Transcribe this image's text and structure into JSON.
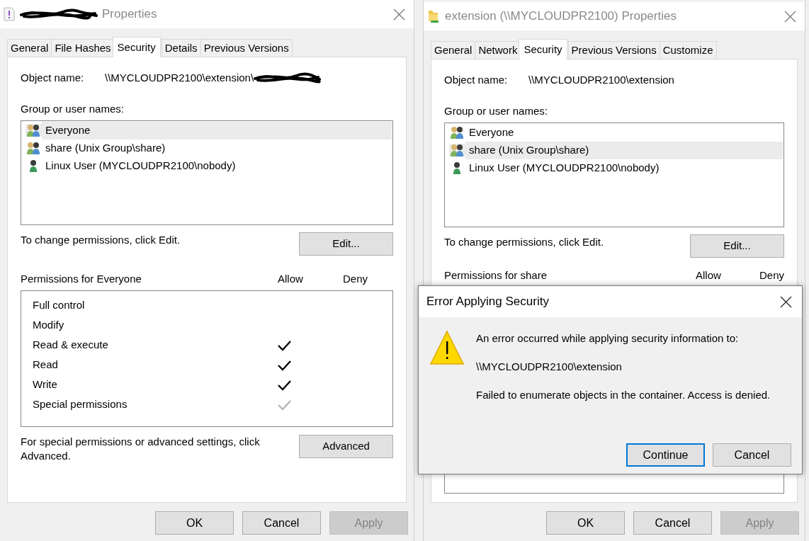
{
  "windows": [
    {
      "title": "Properties",
      "title_redacted": true,
      "tabs": [
        {
          "label": "General",
          "selected": false
        },
        {
          "label": "File Hashes",
          "selected": false
        },
        {
          "label": "Security",
          "selected": true
        },
        {
          "label": "Details",
          "selected": false
        },
        {
          "label": "Previous Versions",
          "selected": false
        }
      ],
      "object_label": "Object name:",
      "object_name": "\\\\MYCLOUDPR2100\\extension\\",
      "object_redacted": true,
      "groups_label": "Group or user names:",
      "groups": [
        {
          "name": "Everyone",
          "kind": "group",
          "selected": true
        },
        {
          "name": "share (Unix Group\\share)",
          "kind": "group",
          "selected": false
        },
        {
          "name": "Linux User (MYCLOUDPR2100\\nobody)",
          "kind": "user",
          "selected": false
        }
      ],
      "change_hint": "To change permissions, click Edit.",
      "edit_button": "Edit...",
      "permissions_label": "Permissions for Everyone",
      "allow_label": "Allow",
      "deny_label": "Deny",
      "permissions": [
        {
          "name": "Full control",
          "allowed": false,
          "inherited": false
        },
        {
          "name": "Modify",
          "allowed": false,
          "inherited": false
        },
        {
          "name": "Read & execute",
          "allowed": true,
          "inherited": false
        },
        {
          "name": "Read",
          "allowed": true,
          "inherited": false
        },
        {
          "name": "Write",
          "allowed": true,
          "inherited": false
        },
        {
          "name": "Special permissions",
          "allowed": true,
          "inherited": true
        }
      ],
      "advanced_hint": "For special permissions or advanced settings, click Advanced.",
      "advanced_button": "Advanced",
      "buttons": [
        {
          "label": "OK",
          "disabled": false
        },
        {
          "label": "Cancel",
          "disabled": false
        },
        {
          "label": "Apply",
          "disabled": true
        }
      ]
    },
    {
      "title": "extension (\\\\MYCLOUDPR2100) Properties",
      "title_redacted": false,
      "tabs": [
        {
          "label": "General",
          "selected": false
        },
        {
          "label": "Network",
          "selected": false
        },
        {
          "label": "Security",
          "selected": true
        },
        {
          "label": "Previous Versions",
          "selected": false
        },
        {
          "label": "Customize",
          "selected": false
        }
      ],
      "object_label": "Object name:",
      "object_name": "\\\\MYCLOUDPR2100\\extension",
      "object_redacted": false,
      "groups_label": "Group or user names:",
      "groups": [
        {
          "name": "Everyone",
          "kind": "group",
          "selected": false
        },
        {
          "name": "share (Unix Group\\share)",
          "kind": "group",
          "selected": true
        },
        {
          "name": "Linux User (MYCLOUDPR2100\\nobody)",
          "kind": "user",
          "selected": false
        }
      ],
      "change_hint": "To change permissions, click Edit.",
      "edit_button": "Edit...",
      "permissions_label": "Permissions for share",
      "allow_label": "Allow",
      "deny_label": "Deny",
      "buttons": [
        {
          "label": "OK",
          "disabled": false
        },
        {
          "label": "Cancel",
          "disabled": false
        },
        {
          "label": "Apply",
          "disabled": true
        }
      ]
    }
  ],
  "error_dialog": {
    "title": "Error Applying Security",
    "lines": [
      "An error occurred while applying security information to:",
      "\\\\MYCLOUDPR2100\\extension",
      "Failed to enumerate objects in the container. Access is denied."
    ],
    "buttons": [
      {
        "label": "Continue",
        "default": true
      },
      {
        "label": "Cancel",
        "default": false
      }
    ]
  }
}
